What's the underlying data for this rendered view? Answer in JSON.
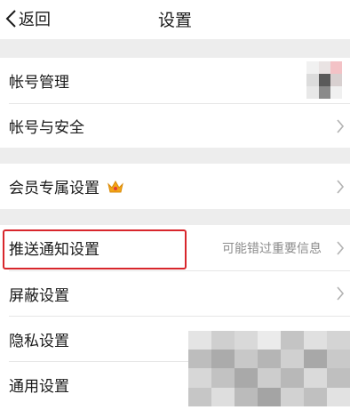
{
  "nav": {
    "back_label": "返回",
    "title": "设置"
  },
  "rows": [
    {
      "label": "帐号管理"
    },
    {
      "label": "帐号与安全"
    },
    {
      "label": "会员专属设置"
    },
    {
      "label": "推送通知设置",
      "sub": "可能错过重要信息"
    },
    {
      "label": "屏蔽设置"
    },
    {
      "label": "隐私设置"
    },
    {
      "label": "通用设置"
    }
  ],
  "icons": {
    "back": "chevron-left-icon",
    "chevron": "chevron-right-icon",
    "crown": "crown-icon"
  },
  "colors": {
    "highlight": "#d8262c",
    "separator_bg": "#ededed",
    "chevron": "#b3b3b3",
    "subtext": "#8c8c8c",
    "crown": "#f2a516"
  }
}
